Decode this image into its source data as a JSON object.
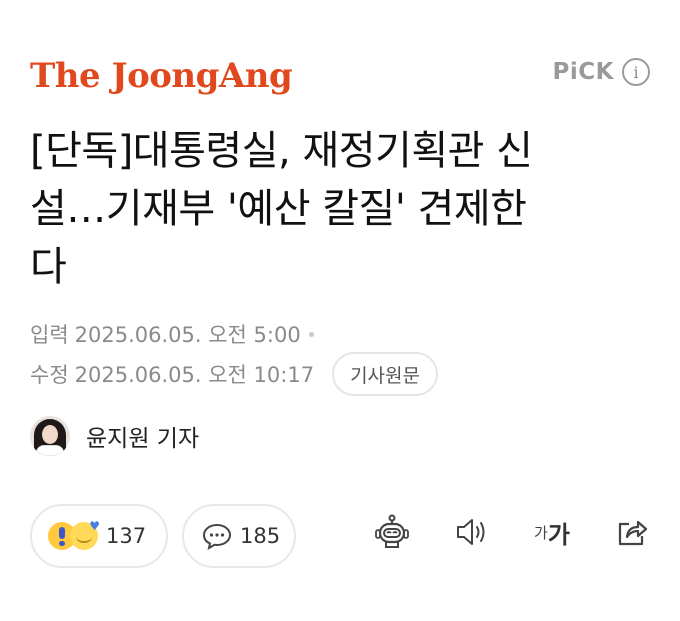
{
  "header": {
    "brand": "The JoongAng",
    "pick_label": "PiCK",
    "pick_info": "i"
  },
  "article": {
    "headline_lines": [
      "[단독]대통령실, 재정기획관 신",
      "설…기재부 '예산 칼질' 견제한",
      "다"
    ],
    "published_label": "입력",
    "published": "2025.06.05. 오전 5:00",
    "updated_label": "수정",
    "updated": "2025.06.05. 오전 10:17",
    "original_button": "기사원문"
  },
  "reporter": {
    "name": "윤지원 기자"
  },
  "actions": {
    "reaction_count": "137",
    "comment_count": "185",
    "font_small": "가",
    "font_large": "가"
  },
  "colors": {
    "brand": "#e0481e",
    "muted": "#8a8a8a"
  }
}
